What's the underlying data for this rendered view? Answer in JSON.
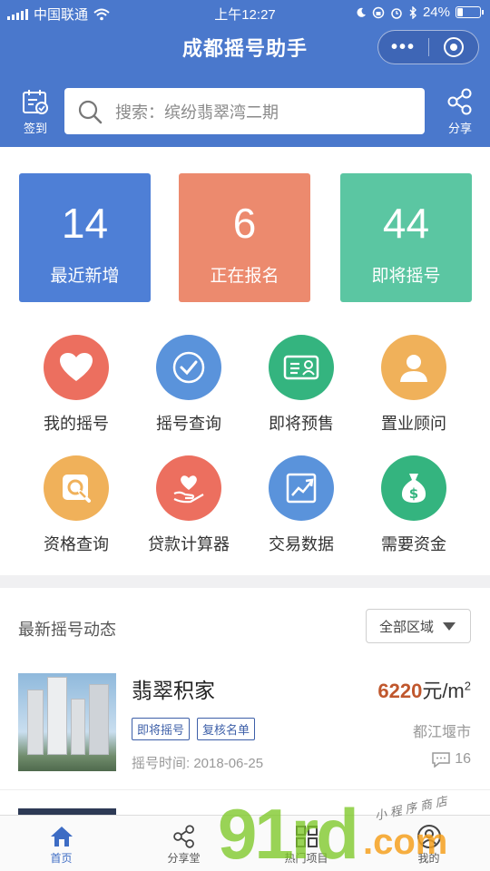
{
  "status_bar": {
    "carrier": "中国联通",
    "time": "上午12:27",
    "battery": "24%",
    "battery_level": 0.24
  },
  "header": {
    "title": "成都摇号助手",
    "capsule_more": "•••",
    "checkin_label": "签到",
    "share_label": "分享",
    "search_placeholder": "搜索：缤纷翡翠湾二期"
  },
  "stats": [
    {
      "value": "14",
      "label": "最近新增",
      "color": "#4e7fd6"
    },
    {
      "value": "6",
      "label": "正在报名",
      "color": "#ec8a6e"
    },
    {
      "value": "44",
      "label": "即将摇号",
      "color": "#5bc6a2"
    }
  ],
  "menu": [
    {
      "label": "我的摇号",
      "icon": "heart-icon",
      "color": "#ec6f5f"
    },
    {
      "label": "摇号查询",
      "icon": "check-icon",
      "color": "#5a93db"
    },
    {
      "label": "即将预售",
      "icon": "id-card-icon",
      "color": "#34b47f"
    },
    {
      "label": "置业顾问",
      "icon": "person-icon",
      "color": "#f0b15a"
    },
    {
      "label": "资格查询",
      "icon": "magnifier-icon",
      "color": "#f0b15a"
    },
    {
      "label": "贷款计算器",
      "icon": "hand-heart-icon",
      "color": "#ec6f5f"
    },
    {
      "label": "交易数据",
      "icon": "trend-chart-icon",
      "color": "#5a93db"
    },
    {
      "label": "需要资金",
      "icon": "money-bag-icon",
      "color": "#34b47f"
    }
  ],
  "feed": {
    "title": "最新摇号动态",
    "filter_label": "全部区域",
    "items": [
      {
        "name": "翡翠积家",
        "tags": [
          "即将摇号",
          "复核名单"
        ],
        "time": "摇号时间: 2018-06-25",
        "price_value": "6220",
        "price_unit": "元/m",
        "price_sup": "2",
        "district": "都江堰市",
        "comments": "16"
      }
    ]
  },
  "tabbar": [
    {
      "label": "首页",
      "active": true
    },
    {
      "label": "分享堂",
      "active": false
    },
    {
      "label": "热门项目",
      "active": false
    },
    {
      "label": "我的",
      "active": false
    }
  ],
  "watermark": {
    "digits": "91rd",
    "domain": ".com",
    "shop": "小程序商店"
  }
}
